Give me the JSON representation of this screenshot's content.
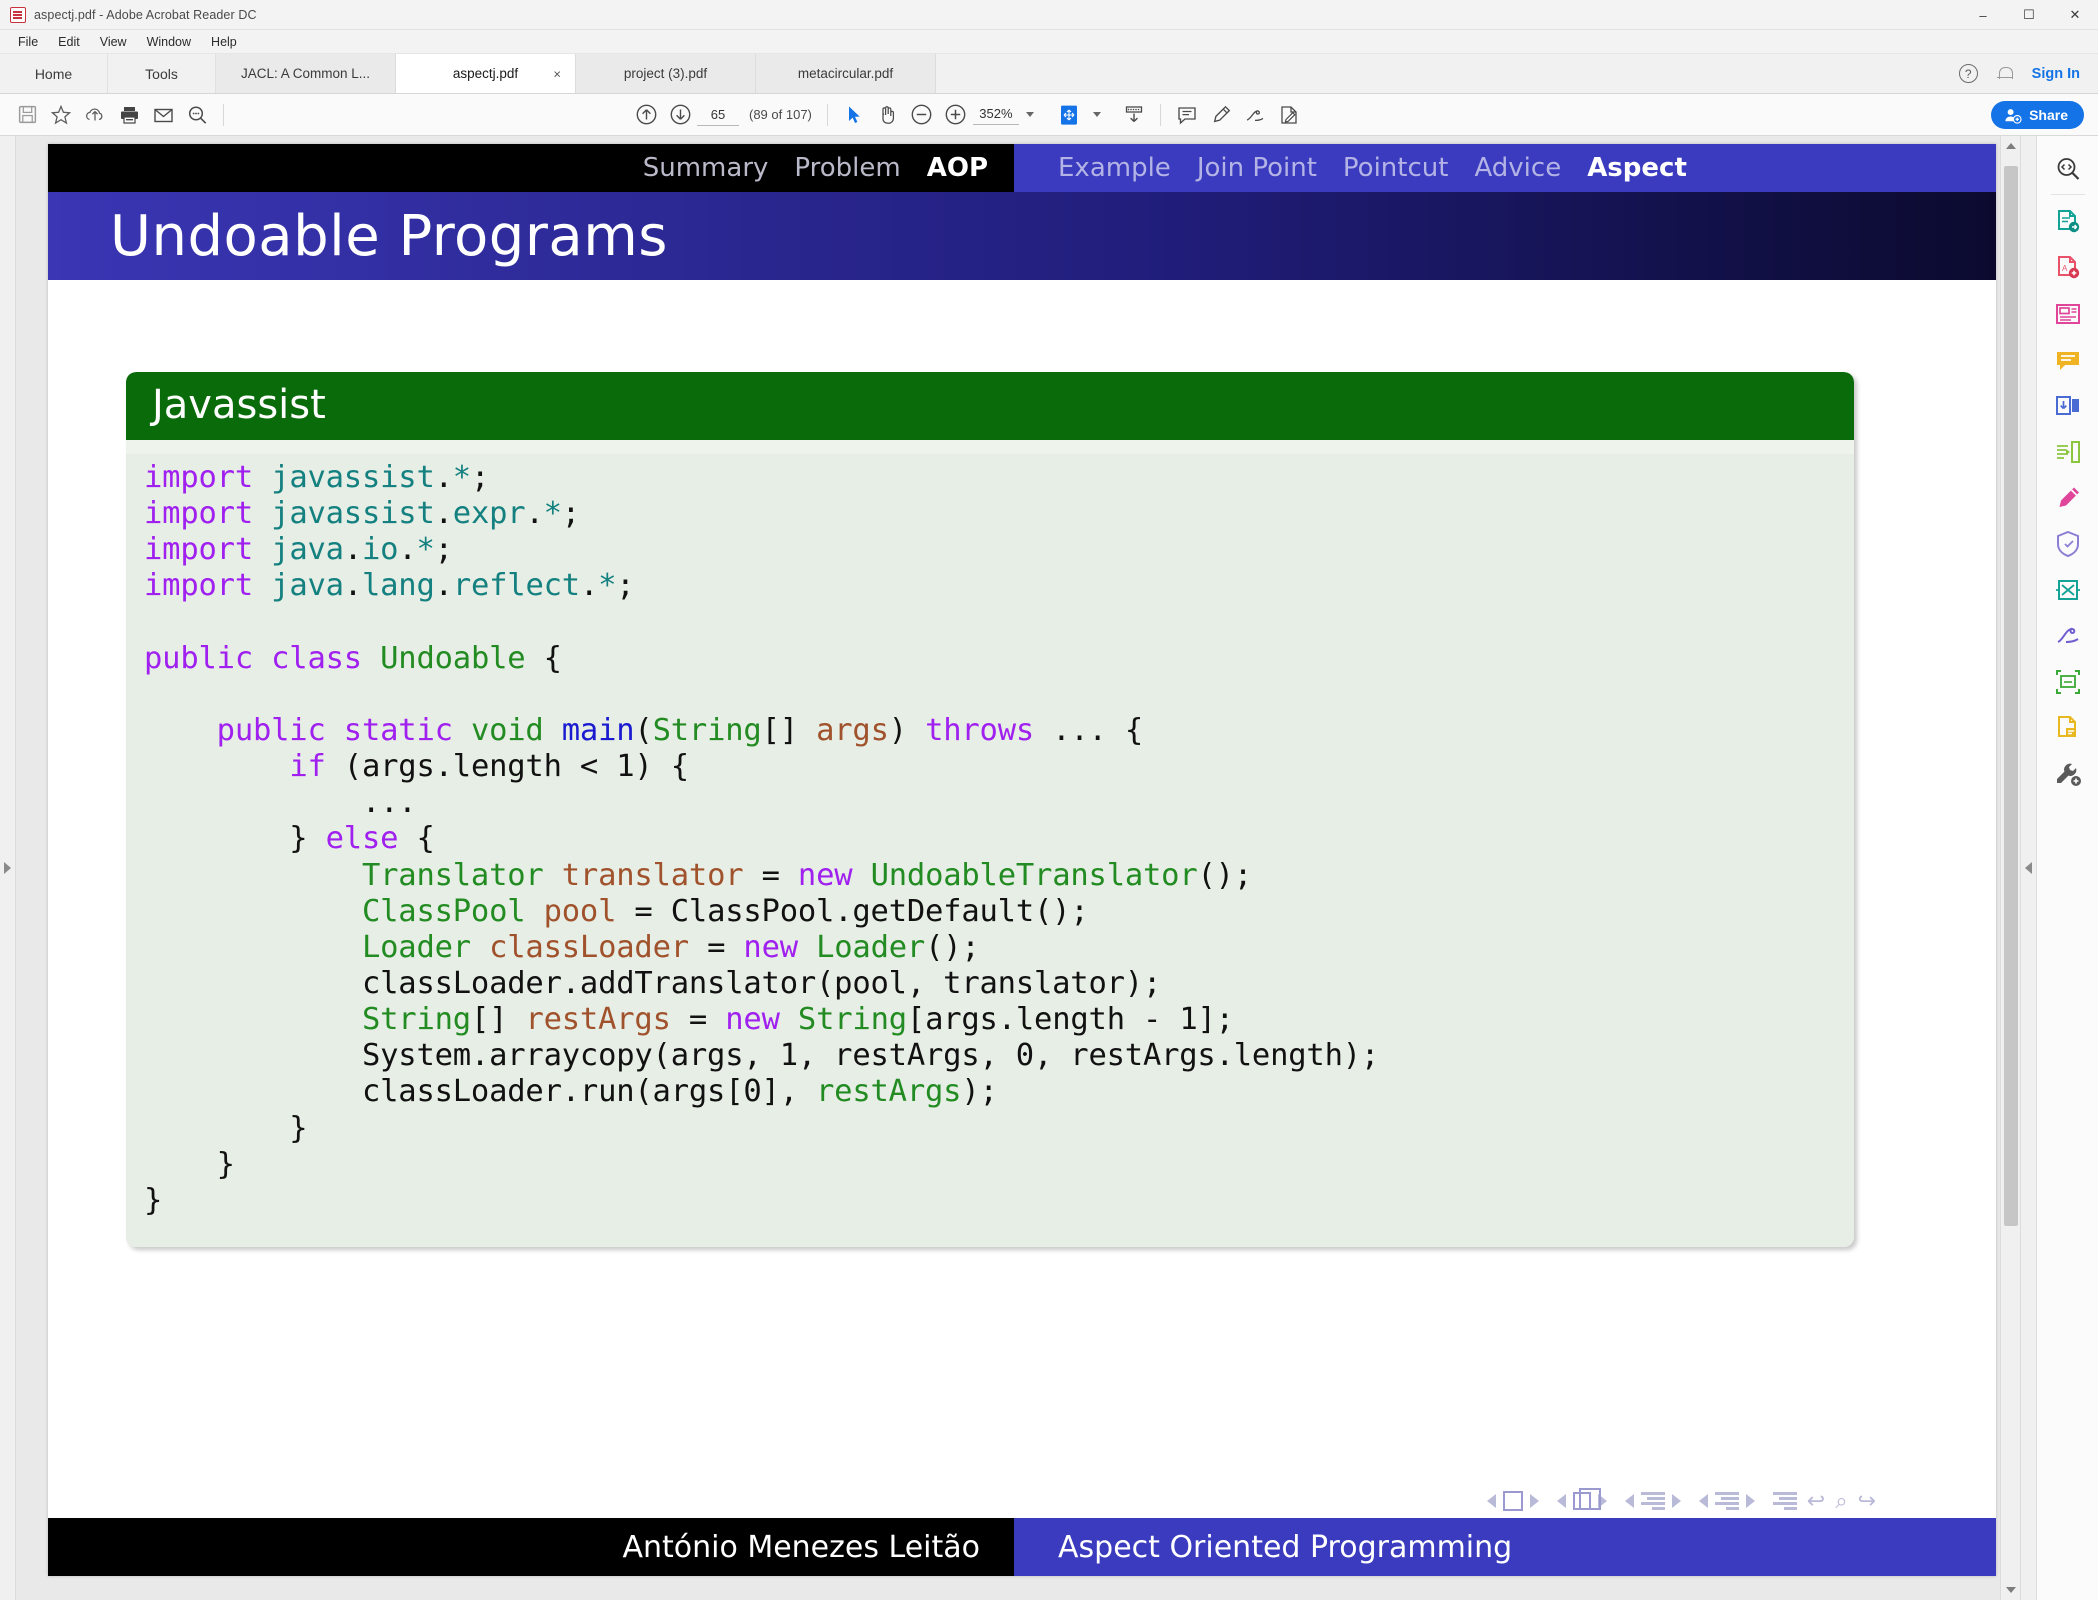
{
  "window": {
    "title": "aspectj.pdf - Adobe Acrobat Reader DC",
    "minimize": "–",
    "maximize": "☐",
    "close": "✕"
  },
  "menu": {
    "items": [
      "File",
      "Edit",
      "View",
      "Window",
      "Help"
    ]
  },
  "tabbar": {
    "nav": [
      "Home",
      "Tools"
    ],
    "documents": [
      {
        "label": "JACL: A Common L...",
        "active": false,
        "closable": false
      },
      {
        "label": "aspectj.pdf",
        "active": true,
        "closable": true,
        "close": "×"
      },
      {
        "label": "project (3).pdf",
        "active": false,
        "closable": false
      },
      {
        "label": "metacircular.pdf",
        "active": false,
        "closable": false
      }
    ],
    "help_glyph": "?",
    "sign_in": "Sign In"
  },
  "toolbar": {
    "page_value": "65",
    "page_of": "(89 of 107)",
    "zoom_value": "352%",
    "share_label": "Share",
    "icons": [
      "save-icon",
      "star-icon",
      "upload-cloud-icon",
      "print-icon",
      "email-icon",
      "search-icon",
      "page-up-icon",
      "page-down-icon",
      "select-cursor-icon",
      "hand-tool-icon",
      "zoom-out-icon",
      "zoom-in-icon",
      "fit-page-icon",
      "scroll-mode-icon",
      "comment-icon",
      "highlight-icon",
      "draw-icon",
      "fill-sign-icon"
    ]
  },
  "slide": {
    "nav_left": [
      {
        "label": "Summary",
        "active": false
      },
      {
        "label": "Problem",
        "active": false
      },
      {
        "label": "AOP",
        "active": true
      }
    ],
    "nav_right": [
      {
        "label": "Example",
        "active": false
      },
      {
        "label": "Join Point",
        "active": false
      },
      {
        "label": "Pointcut",
        "active": false
      },
      {
        "label": "Advice",
        "active": false
      },
      {
        "label": "Aspect",
        "active": true
      }
    ],
    "title": "Undoable Programs",
    "block_title": "Javassist",
    "footer_author": "António Menezes Leitão",
    "footer_course": "Aspect Oriented Programming",
    "code_lines": [
      [
        {
          "t": "import",
          "c": "k"
        },
        {
          "t": " ",
          "c": "pl"
        },
        {
          "t": "javassist",
          "c": "pk"
        },
        {
          "t": ".",
          "c": "pl"
        },
        {
          "t": "*",
          "c": "pk"
        },
        {
          "t": ";",
          "c": "pl"
        }
      ],
      [
        {
          "t": "import",
          "c": "k"
        },
        {
          "t": " ",
          "c": "pl"
        },
        {
          "t": "javassist",
          "c": "pk"
        },
        {
          "t": ".",
          "c": "pl"
        },
        {
          "t": "expr",
          "c": "pk"
        },
        {
          "t": ".",
          "c": "pl"
        },
        {
          "t": "*",
          "c": "pk"
        },
        {
          "t": ";",
          "c": "pl"
        }
      ],
      [
        {
          "t": "import",
          "c": "k"
        },
        {
          "t": " ",
          "c": "pl"
        },
        {
          "t": "java",
          "c": "pk"
        },
        {
          "t": ".",
          "c": "pl"
        },
        {
          "t": "io",
          "c": "pk"
        },
        {
          "t": ".",
          "c": "pl"
        },
        {
          "t": "*",
          "c": "pk"
        },
        {
          "t": ";",
          "c": "pl"
        }
      ],
      [
        {
          "t": "import",
          "c": "k"
        },
        {
          "t": " ",
          "c": "pl"
        },
        {
          "t": "java",
          "c": "pk"
        },
        {
          "t": ".",
          "c": "pl"
        },
        {
          "t": "lang",
          "c": "pk"
        },
        {
          "t": ".",
          "c": "pl"
        },
        {
          "t": "reflect",
          "c": "pk"
        },
        {
          "t": ".",
          "c": "pl"
        },
        {
          "t": "*",
          "c": "pk"
        },
        {
          "t": ";",
          "c": "pl"
        }
      ],
      [],
      [
        {
          "t": "public class ",
          "c": "k"
        },
        {
          "t": "Undoable",
          "c": "ty"
        },
        {
          "t": " {",
          "c": "pl"
        }
      ],
      [],
      [
        {
          "t": "    ",
          "c": "pl"
        },
        {
          "t": "public static ",
          "c": "k"
        },
        {
          "t": "void",
          "c": "ty"
        },
        {
          "t": " ",
          "c": "pl"
        },
        {
          "t": "main",
          "c": "fn"
        },
        {
          "t": "(",
          "c": "pl"
        },
        {
          "t": "String",
          "c": "ty"
        },
        {
          "t": "[] ",
          "c": "pl"
        },
        {
          "t": "args",
          "c": "va"
        },
        {
          "t": ") ",
          "c": "pl"
        },
        {
          "t": "throws",
          "c": "k"
        },
        {
          "t": " ... {",
          "c": "pl"
        }
      ],
      [
        {
          "t": "        ",
          "c": "pl"
        },
        {
          "t": "if",
          "c": "k"
        },
        {
          "t": " (args.length < 1) {",
          "c": "pl"
        }
      ],
      [
        {
          "t": "            ...",
          "c": "pl"
        }
      ],
      [
        {
          "t": "        } ",
          "c": "pl"
        },
        {
          "t": "else",
          "c": "k"
        },
        {
          "t": " {",
          "c": "pl"
        }
      ],
      [
        {
          "t": "            ",
          "c": "pl"
        },
        {
          "t": "Translator",
          "c": "ty"
        },
        {
          "t": " ",
          "c": "pl"
        },
        {
          "t": "translator",
          "c": "va"
        },
        {
          "t": " = ",
          "c": "pl"
        },
        {
          "t": "new",
          "c": "k"
        },
        {
          "t": " ",
          "c": "pl"
        },
        {
          "t": "UndoableTranslator",
          "c": "ty"
        },
        {
          "t": "();",
          "c": "pl"
        }
      ],
      [
        {
          "t": "            ",
          "c": "pl"
        },
        {
          "t": "ClassPool",
          "c": "ty"
        },
        {
          "t": " ",
          "c": "pl"
        },
        {
          "t": "pool",
          "c": "va"
        },
        {
          "t": " = ClassPool.getDefault();",
          "c": "pl"
        }
      ],
      [
        {
          "t": "            ",
          "c": "pl"
        },
        {
          "t": "Loader",
          "c": "ty"
        },
        {
          "t": " ",
          "c": "pl"
        },
        {
          "t": "classLoader",
          "c": "va"
        },
        {
          "t": " = ",
          "c": "pl"
        },
        {
          "t": "new",
          "c": "k"
        },
        {
          "t": " ",
          "c": "pl"
        },
        {
          "t": "Loader",
          "c": "ty"
        },
        {
          "t": "();",
          "c": "pl"
        }
      ],
      [
        {
          "t": "            classLoader.addTranslator(pool, translator);",
          "c": "pl"
        }
      ],
      [
        {
          "t": "            ",
          "c": "pl"
        },
        {
          "t": "String",
          "c": "ty"
        },
        {
          "t": "[] ",
          "c": "pl"
        },
        {
          "t": "restArgs",
          "c": "va"
        },
        {
          "t": " = ",
          "c": "pl"
        },
        {
          "t": "new",
          "c": "k"
        },
        {
          "t": " ",
          "c": "pl"
        },
        {
          "t": "String",
          "c": "ty"
        },
        {
          "t": "[args.length - 1];",
          "c": "pl"
        }
      ],
      [
        {
          "t": "            System.arraycopy(args, 1, restArgs, 0, restArgs.length);",
          "c": "pl"
        }
      ],
      [
        {
          "t": "            classLoader.run(args[0], ",
          "c": "pl"
        },
        {
          "t": "restArgs",
          "c": "ty"
        },
        {
          "t": ");",
          "c": "pl"
        }
      ],
      [
        {
          "t": "        }",
          "c": "pl"
        }
      ],
      [
        {
          "t": "    }",
          "c": "pl"
        }
      ],
      [
        {
          "t": "}",
          "c": "pl"
        }
      ]
    ]
  },
  "right_rail": {
    "tools": [
      "search-document-icon",
      "export-pdf-icon",
      "create-pdf-icon",
      "organize-pages-icon",
      "comment-icon",
      "combine-files-icon",
      "compress-pdf-icon",
      "edit-pdf-icon",
      "protect-icon",
      "redact-icon",
      "fill-and-sign-icon",
      "scan-ocr-icon",
      "stamp-icon",
      "more-tools-icon"
    ]
  },
  "colors": {
    "accent_blue": "#1473e6",
    "slide_blue": "#3b3bbf",
    "block_green": "#0a6b0a",
    "block_bg": "#e7eee5",
    "keyword_purple": "#a020f0",
    "package_teal": "#148080",
    "type_green": "#228b22",
    "variable_brown": "#a0522d",
    "function_blue": "#1a1ad0"
  }
}
